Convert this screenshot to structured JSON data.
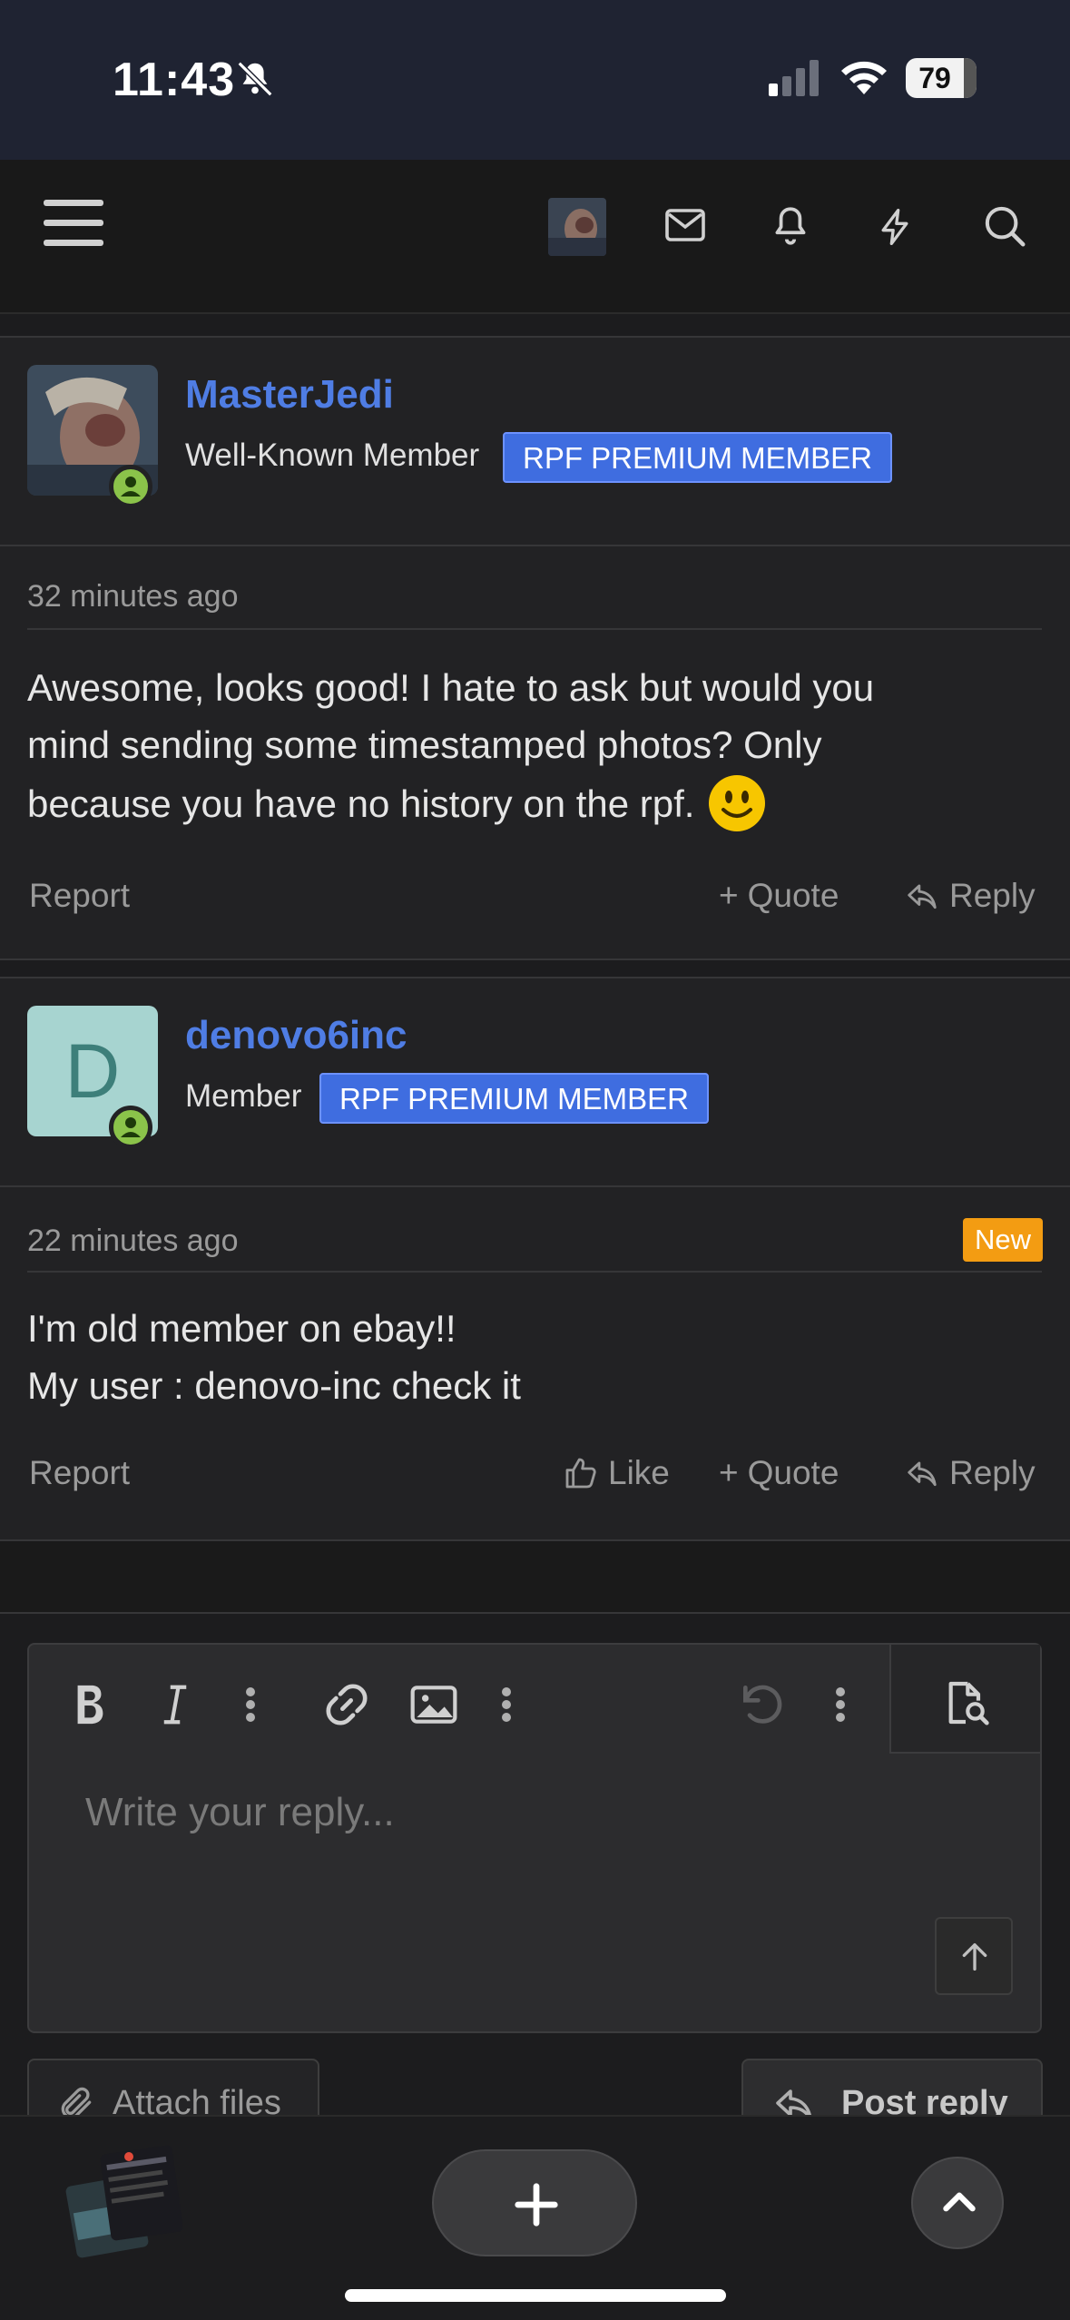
{
  "status_bar": {
    "time": "11:43",
    "battery": "79"
  },
  "nav": {
    "icons": [
      "menu-icon",
      "avatar",
      "envelope-icon",
      "bell-icon",
      "bolt-icon",
      "search-icon"
    ]
  },
  "posts": [
    {
      "username": "MasterJedi",
      "title": "Well-Known Member",
      "badge": "RPF PREMIUM MEMBER",
      "time": "32 minutes ago",
      "body_lines": [
        "Awesome, looks good! I hate to ask but would you",
        "mind sending some timestamped photos? Only",
        "because you have no history on the rpf."
      ],
      "actions": {
        "report": "Report",
        "quote": "Quote",
        "reply": "Reply"
      }
    },
    {
      "username": "denovo6inc",
      "avatar_letter": "D",
      "title": "Member",
      "badge": "RPF PREMIUM MEMBER",
      "time": "22 minutes ago",
      "new_label": "New",
      "body_lines": [
        "I'm old member on ebay!!",
        "My user : denovo-inc check it"
      ],
      "actions": {
        "report": "Report",
        "like": "Like",
        "quote": "Quote",
        "reply": "Reply"
      }
    }
  ],
  "editor": {
    "placeholder": "Write your reply...",
    "attach_label": "Attach files",
    "post_label": "Post reply"
  },
  "colors": {
    "accent": "#4f7de4",
    "badge": "#3f6de0",
    "new": "#f39c12",
    "online": "#8bc34a"
  }
}
